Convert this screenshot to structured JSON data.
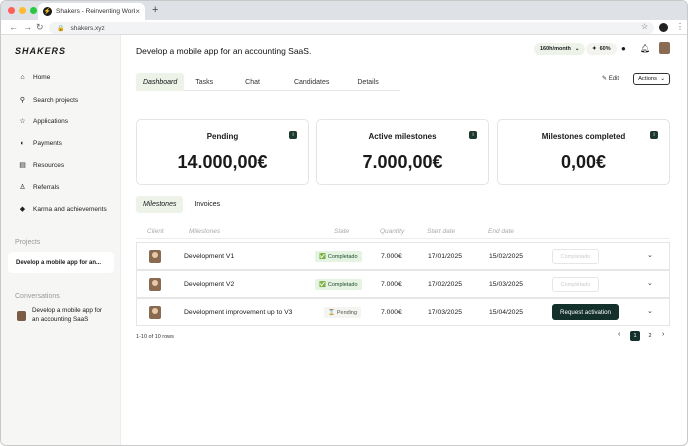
{
  "browser": {
    "tab_title": "Shakers - Reinventing Work",
    "url": "shakers.xyz",
    "colors": {
      "close": "#ff5f57",
      "minimize": "#febc2e",
      "maximize": "#28c840"
    }
  },
  "sidebar": {
    "logo": "SHAKERS",
    "items": [
      {
        "label": "Home",
        "icon": "home-icon"
      },
      {
        "label": "Search projects",
        "icon": "search-icon"
      },
      {
        "label": "Applications",
        "icon": "star-icon"
      },
      {
        "label": "Payments",
        "icon": "coin-icon"
      },
      {
        "label": "Resources",
        "icon": "database-icon"
      },
      {
        "label": "Referrals",
        "icon": "user-icon"
      },
      {
        "label": "Karma and achievements",
        "icon": "diamond-icon"
      }
    ],
    "projects_heading": "Projects",
    "project_item": "Develop a mobile app for an...",
    "conversations_heading": "Conversations",
    "conversation_line1": "Develop a mobile app for",
    "conversation_line2": "an accounting SaaS"
  },
  "header": {
    "title": "Develop a mobile app for an accounting SaaS.",
    "hours": "160h/month",
    "karma": "60%"
  },
  "tabs": [
    "Dashboard",
    "Tasks",
    "Chat",
    "Candidates",
    "Details"
  ],
  "actions": {
    "edit": "Edit",
    "actions": "Actions"
  },
  "cards": [
    {
      "title": "Pending",
      "value": "14.000,00€"
    },
    {
      "title": "Active milestones",
      "value": "7.000,00€"
    },
    {
      "title": "Milestones completed",
      "value": "0,00€"
    }
  ],
  "subtabs": [
    "Milestones",
    "Invoices"
  ],
  "table": {
    "headers": [
      "Client",
      "Milestones",
      "State",
      "Quantity",
      "Start date",
      "End date"
    ],
    "rows": [
      {
        "milestone": "Development V1",
        "state": "Completado",
        "quantity": "7.000€",
        "start": "17/01/2025",
        "end": "15/02/2025",
        "action": "Completado"
      },
      {
        "milestone": "Development V2",
        "state": "Completado",
        "quantity": "7.000€",
        "start": "17/02/2025",
        "end": "15/03/2025",
        "action": "Completado"
      },
      {
        "milestone": "Development improvement up to V3",
        "state": "Pending",
        "quantity": "7.000€",
        "start": "17/03/2025",
        "end": "15/04/2025",
        "action": "Request activation"
      }
    ]
  },
  "pagination": {
    "summary": "1-10 of 10 rows",
    "pages": [
      "1",
      "2"
    ]
  }
}
